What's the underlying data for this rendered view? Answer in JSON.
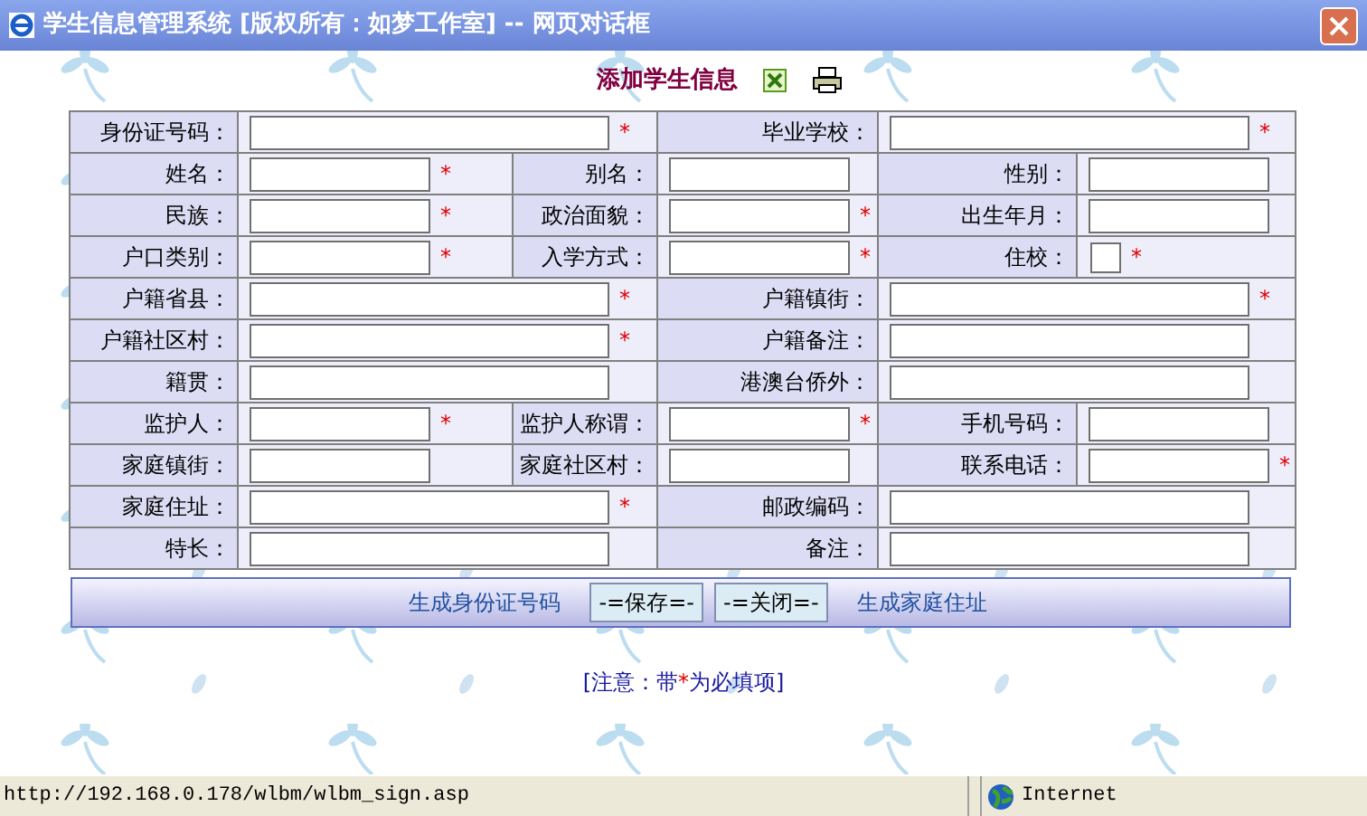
{
  "window": {
    "title": "学生信息管理系统 [版权所有：如梦工作室] -- 网页对话框"
  },
  "header": {
    "title": "添加学生信息"
  },
  "required_mark": "*",
  "form": {
    "rows": [
      {
        "kind": "wide",
        "fields": [
          {
            "label": "身份证号码：",
            "kind": "text",
            "required": true
          },
          {
            "label": "毕业学校：",
            "kind": "text",
            "required": true
          }
        ]
      },
      {
        "kind": "triple",
        "fields": [
          {
            "label": "姓名：",
            "kind": "text",
            "required": true
          },
          {
            "label": "别名：",
            "kind": "text",
            "required": false
          },
          {
            "label": "性别：",
            "kind": "text",
            "required": false
          }
        ]
      },
      {
        "kind": "triple",
        "fields": [
          {
            "label": "民族：",
            "kind": "text",
            "required": true
          },
          {
            "label": "政治面貌：",
            "kind": "text",
            "required": true
          },
          {
            "label": "出生年月：",
            "kind": "text",
            "required": false
          }
        ]
      },
      {
        "kind": "triple",
        "fields": [
          {
            "label": "户口类别：",
            "kind": "text",
            "required": true
          },
          {
            "label": "入学方式：",
            "kind": "text",
            "required": true
          },
          {
            "label": "住校：",
            "kind": "checkbox",
            "checked": false,
            "required": true
          }
        ]
      },
      {
        "kind": "wide",
        "fields": [
          {
            "label": "户籍省县：",
            "kind": "text",
            "required": true
          },
          {
            "label": "户籍镇街：",
            "kind": "text",
            "required": true
          }
        ]
      },
      {
        "kind": "wide",
        "fields": [
          {
            "label": "户籍社区村：",
            "kind": "text",
            "required": true
          },
          {
            "label": "户籍备注：",
            "kind": "text",
            "required": false
          }
        ]
      },
      {
        "kind": "wide",
        "fields": [
          {
            "label": "籍贯：",
            "kind": "text",
            "required": false
          },
          {
            "label": "港澳台侨外：",
            "kind": "text",
            "required": false
          }
        ]
      },
      {
        "kind": "triple",
        "fields": [
          {
            "label": "监护人：",
            "kind": "text",
            "required": true
          },
          {
            "label": "监护人称谓：",
            "kind": "text",
            "required": true
          },
          {
            "label": "手机号码：",
            "kind": "text",
            "required": false
          }
        ]
      },
      {
        "kind": "triple",
        "fields": [
          {
            "label": "家庭镇街：",
            "kind": "text",
            "required": false
          },
          {
            "label": "家庭社区村：",
            "kind": "text",
            "required": false
          },
          {
            "label": "联系电话：",
            "kind": "text",
            "required": true
          }
        ]
      },
      {
        "kind": "wide",
        "fields": [
          {
            "label": "家庭住址：",
            "kind": "text",
            "required": true
          },
          {
            "label": "邮政编码：",
            "kind": "text",
            "required": false
          }
        ]
      },
      {
        "kind": "wide",
        "fields": [
          {
            "label": "特长：",
            "kind": "text",
            "required": false
          },
          {
            "label": "备注：",
            "kind": "text",
            "required": false
          }
        ]
      }
    ]
  },
  "actions": [
    {
      "kind": "link",
      "label": "生成身份证号码"
    },
    {
      "kind": "button",
      "label": "-=保存=-"
    },
    {
      "kind": "button",
      "label": "-=关闭=-"
    },
    {
      "kind": "link",
      "label": "生成家庭住址"
    }
  ],
  "note": {
    "before": "[注意：带",
    "after": "为必填项]"
  },
  "status_bar": {
    "url": "http://192.168.0.178/wlbm/wlbm_sign.asp",
    "zone": "Internet"
  }
}
